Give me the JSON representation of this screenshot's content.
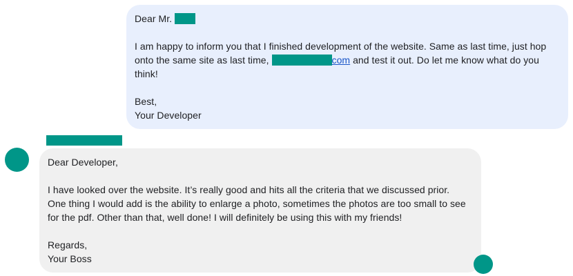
{
  "outgoing_message": {
    "greeting": "Dear Mr.",
    "body_line1": "I am happy to inform you that I finished development of the website. Same as last time, just hop",
    "body_line2_before": "onto the same site as last time,",
    "link_tail": "com",
    "body_line2_after": "and test it out. Do let me know what do you",
    "body_line3": "think!",
    "signoff": "Best,",
    "signature": "Your Developer"
  },
  "incoming_message": {
    "greeting": "Dear Developer,",
    "body_line1": "I have looked over the website. It’s really good and hits all the criteria that we discussed prior.",
    "body_line2": "One thing I would add is the ability to enlarge a photo, sometimes the photos are too small to see",
    "body_line3": "for the pdf. Other than that, well done! I will definitely be using this with my friends!",
    "signoff": "Regards,",
    "signature": "Your Boss"
  },
  "colors": {
    "outgoing_bubble": "#e8effd",
    "incoming_bubble": "#f0f0f0",
    "redaction": "#009688",
    "link": "#1a56c7"
  },
  "icons": {
    "sender_avatar": "avatar-circle",
    "read_receipt": "avatar-circle"
  }
}
